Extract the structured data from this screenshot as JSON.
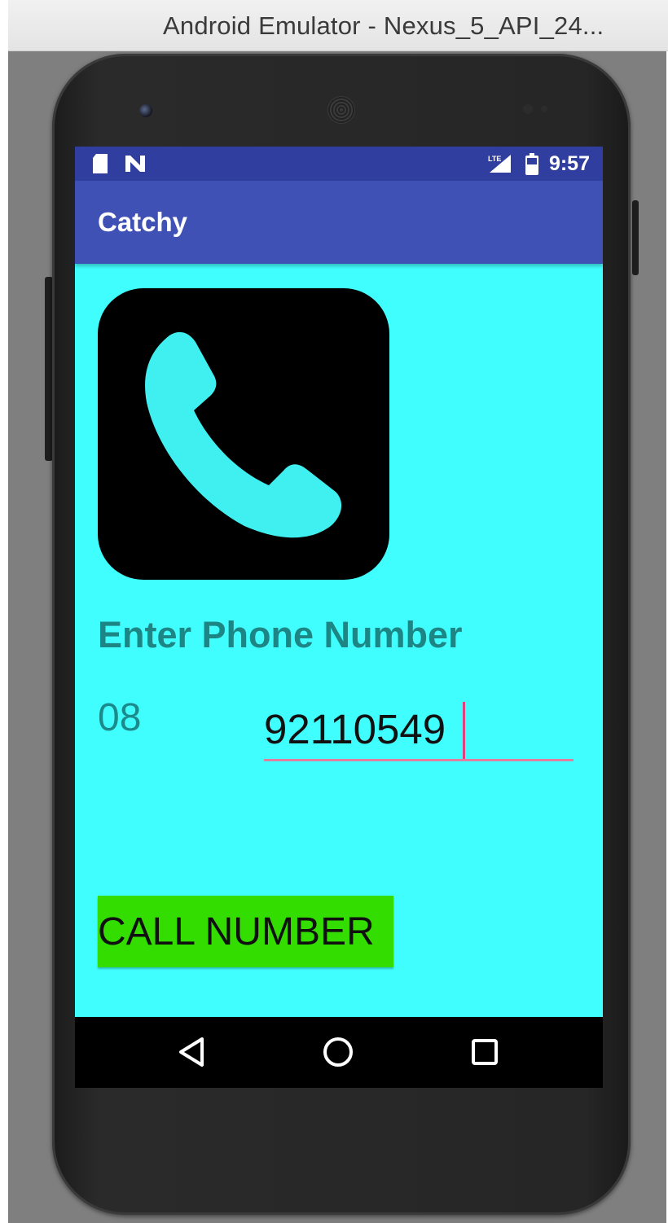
{
  "window": {
    "title": "Android Emulator - Nexus_5_API_24..."
  },
  "status_bar": {
    "time": "9:57",
    "icons": [
      "sd-card-icon",
      "n-notification-icon",
      "lte-signal-icon",
      "battery-icon"
    ]
  },
  "app_bar": {
    "title": "Catchy"
  },
  "main": {
    "image_icon": "phone-handset-icon",
    "heading": "Enter Phone Number",
    "prefix": "08",
    "phone_input_value": "92110549",
    "call_button_label": "CALL NUMBER"
  },
  "nav_bar": {
    "icons": [
      "back-icon",
      "home-icon",
      "recents-icon"
    ]
  },
  "colors": {
    "status_bar": "#303f9f",
    "app_bar": "#3f51b5",
    "content_background": "#40fefe",
    "heading_text": "#1e8585",
    "input_underline": "#e07fa0",
    "button_background": "#33dd00",
    "phone_glyph": "#40f0f0"
  }
}
